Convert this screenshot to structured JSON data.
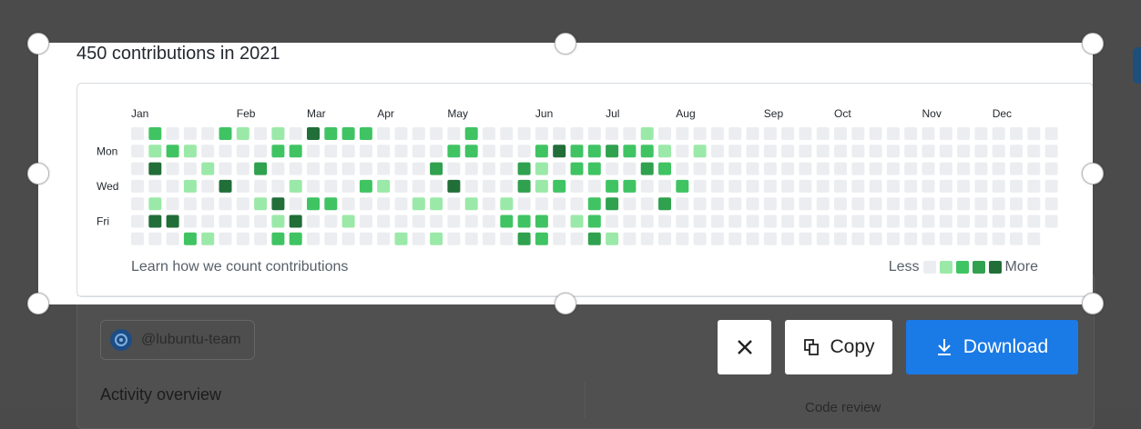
{
  "background_page": {
    "org_handle": "@lubuntu-team",
    "activity_title": "Activity overview",
    "code_review": "Code review"
  },
  "contributions": {
    "title": "450 contributions in 2021",
    "months": [
      "Jan",
      "Feb",
      "Mar",
      "Apr",
      "May",
      "Jun",
      "Jul",
      "Aug",
      "Sep",
      "Oct",
      "Nov",
      "Dec"
    ],
    "weekday_labels": [
      "Mon",
      "Wed",
      "Fri"
    ],
    "learn_link": "Learn how we count contributions",
    "legend_less": "Less",
    "legend_more": "More",
    "level_colors": [
      "#ebedf0",
      "#9be9a8",
      "#40c463",
      "#30a14e",
      "#216e39"
    ],
    "weeks": 53,
    "grid": [
      "0000000020201000000000000000002000000000000001000000000000000000000000000000000000000000000000000000000000000000000000000000000000000000000000000000000000000000000000000000000000000000000000000000000000000000000000000000000000000000000000000000000000000000000000000000000000000000000000000000000000000000000000000000000000000000000000000000000000000000",
      "0012200000000220000000000000022000000334443321010000000000000000000000000000000000000000000000000000000000000000000000000000000000000000000000000000000000000000000000000000000000000000000000000000000000000000000000000000000000000000000000000000000000000000000000000000000000000000000000000000000000000000000000000000000000000000000000000000000000000000",
      "0400010300000000000000000030000004100220003302000000000000000000000000000000000000000000000000000000000000000000000000000000000000000000000000000000000000000000000000000000000000000000000000000000000000000000000000000000000000000000000000000000000000000000000000000000000000000000000000000000000000000000000000000000000000000000000000000000000000000000",
      "0000104000000010002100000040000031100000022000200000000000000000000000000000000000000000000000000000000000000000000000000000000000000000000000000000000000000000000000000000000000000000000000000000000000000000000000000000000000000000000000000000000000000000000000000000000000000000000000000000000000000000000000000000000000000000000000000000000000000000"
    ]
  },
  "actions": {
    "copy_label": "Copy",
    "download_label": "Download"
  },
  "colors": {
    "download_bg": "#1a7ae6",
    "overlay": "#4a4a4a"
  }
}
